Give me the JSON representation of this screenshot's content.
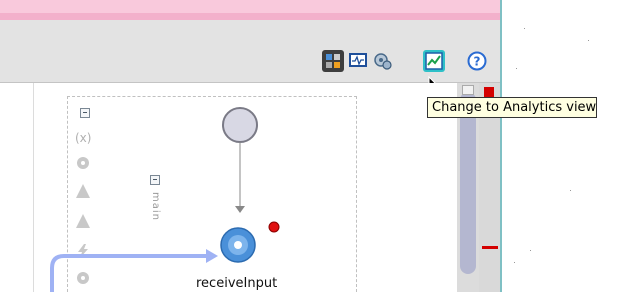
{
  "toolbar": {
    "buttons": [
      {
        "icon": "structure-view-icon",
        "state": "active"
      },
      {
        "icon": "monitor-view-icon",
        "state": "normal"
      },
      {
        "icon": "integration-view-icon",
        "state": "normal"
      },
      {
        "icon": "analytics-view-icon",
        "state": "hover"
      },
      {
        "icon": "help-icon",
        "state": "normal"
      }
    ],
    "tooltip": "Change to Analytics view"
  },
  "diagram": {
    "scope_label": "main",
    "activity_label": "receiveInput",
    "palette_icons": [
      "variable-icon",
      "gear-shape-icon",
      "triangle-icon",
      "triangle-icon",
      "lightning-icon",
      "gear-shape-icon"
    ],
    "palette_variable_glyph": "(x)"
  },
  "colors": {
    "pink_bar": "#f9c9dc",
    "toolbar_bg": "#e3e3e3",
    "tooltip_bg": "#ffffe1",
    "hover_button": "#2ec0c8",
    "receive_node": "#4a90d9",
    "error_dot": "#e01010",
    "scroll_thumb": "#b4b7d0",
    "overview_marker": "#d40000"
  }
}
